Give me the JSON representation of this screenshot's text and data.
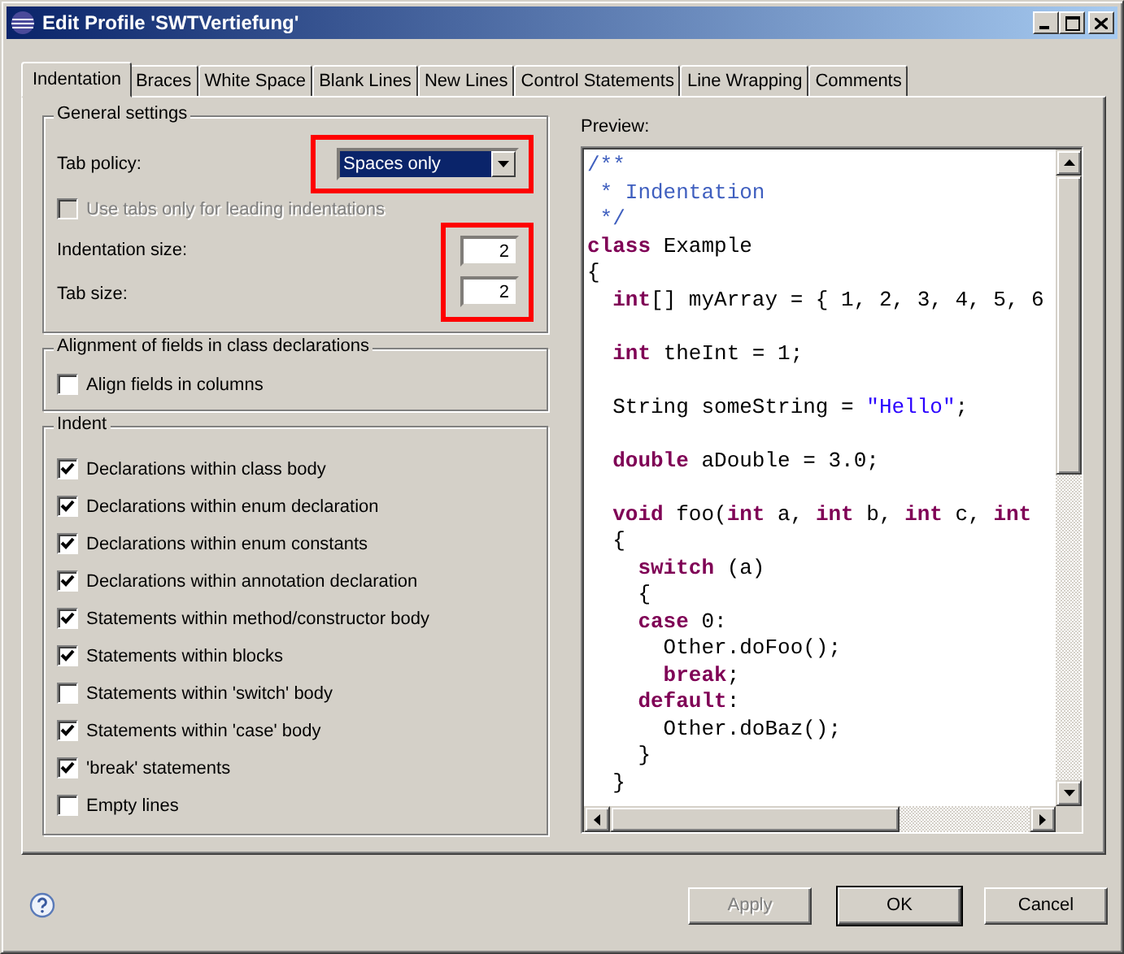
{
  "window": {
    "title": "Edit Profile 'SWTVertiefung'"
  },
  "tabs": [
    {
      "label": "Indentation",
      "selected": true
    },
    {
      "label": "Braces",
      "selected": false
    },
    {
      "label": "White Space",
      "selected": false
    },
    {
      "label": "Blank Lines",
      "selected": false
    },
    {
      "label": "New Lines",
      "selected": false
    },
    {
      "label": "Control Statements",
      "selected": false
    },
    {
      "label": "Line Wrapping",
      "selected": false
    },
    {
      "label": "Comments",
      "selected": false
    }
  ],
  "general_settings": {
    "title": "General settings",
    "tab_policy": {
      "label": "Tab policy:",
      "value": "Spaces only",
      "highlighted": true
    },
    "use_tabs_checkbox": {
      "label": "Use tabs only for leading indentations",
      "checked": false,
      "disabled": true
    },
    "sizes": {
      "highlighted": true,
      "fields": [
        {
          "label": "Indentation size:",
          "value": "2"
        },
        {
          "label": "Tab size:",
          "value": "2"
        }
      ]
    }
  },
  "alignment": {
    "title": "Alignment of fields in class declarations",
    "options": [
      {
        "label": "Align fields in columns",
        "checked": false
      }
    ]
  },
  "indent": {
    "title": "Indent",
    "options": [
      {
        "label": "Declarations within class body",
        "checked": true
      },
      {
        "label": "Declarations within enum declaration",
        "checked": true
      },
      {
        "label": "Declarations within enum constants",
        "checked": true
      },
      {
        "label": "Declarations within annotation declaration",
        "checked": true
      },
      {
        "label": "Statements within method/constructor body",
        "checked": true
      },
      {
        "label": "Statements within blocks",
        "checked": true
      },
      {
        "label": "Statements within 'switch' body",
        "checked": false
      },
      {
        "label": "Statements within 'case' body",
        "checked": true
      },
      {
        "label": "'break' statements",
        "checked": true
      },
      {
        "label": "Empty lines",
        "checked": false
      }
    ]
  },
  "preview": {
    "label": "Preview:",
    "lines": [
      {
        "kind": "code",
        "tokens": [
          {
            "kind": "comment",
            "text": "/**"
          }
        ]
      },
      {
        "kind": "code",
        "tokens": [
          {
            "kind": "comment",
            "text": " * Indentation"
          }
        ]
      },
      {
        "kind": "code",
        "tokens": [
          {
            "kind": "comment",
            "text": " */"
          }
        ]
      },
      {
        "kind": "code",
        "tokens": [
          {
            "kind": "keyword",
            "text": "class"
          },
          {
            "kind": "plain",
            "text": " Example"
          }
        ]
      },
      {
        "kind": "code",
        "tokens": [
          {
            "kind": "plain",
            "text": "{"
          }
        ]
      },
      {
        "kind": "code",
        "tokens": [
          {
            "kind": "keyword",
            "text": "  int"
          },
          {
            "kind": "plain",
            "text": "[] myArray = { 1, 2, 3, 4, 5, 6"
          }
        ]
      },
      {
        "kind": "blank"
      },
      {
        "kind": "code",
        "tokens": [
          {
            "kind": "keyword",
            "text": "  int"
          },
          {
            "kind": "plain",
            "text": " theInt = 1;"
          }
        ]
      },
      {
        "kind": "blank"
      },
      {
        "kind": "code",
        "tokens": [
          {
            "kind": "plain",
            "text": "  String someString = "
          },
          {
            "kind": "string",
            "text": "\"Hello\""
          },
          {
            "kind": "plain",
            "text": ";"
          }
        ]
      },
      {
        "kind": "blank"
      },
      {
        "kind": "code",
        "tokens": [
          {
            "kind": "keyword",
            "text": "  double"
          },
          {
            "kind": "plain",
            "text": " aDouble = 3.0;"
          }
        ]
      },
      {
        "kind": "blank"
      },
      {
        "kind": "code",
        "tokens": [
          {
            "kind": "keyword",
            "text": "  void"
          },
          {
            "kind": "plain",
            "text": " foo("
          },
          {
            "kind": "keyword",
            "text": "int"
          },
          {
            "kind": "plain",
            "text": " a, "
          },
          {
            "kind": "keyword",
            "text": "int"
          },
          {
            "kind": "plain",
            "text": " b, "
          },
          {
            "kind": "keyword",
            "text": "int"
          },
          {
            "kind": "plain",
            "text": " c, "
          },
          {
            "kind": "keyword",
            "text": "int"
          }
        ]
      },
      {
        "kind": "code",
        "tokens": [
          {
            "kind": "plain",
            "text": "  {"
          }
        ]
      },
      {
        "kind": "code",
        "tokens": [
          {
            "kind": "keyword",
            "text": "    switch"
          },
          {
            "kind": "plain",
            "text": " (a)"
          }
        ]
      },
      {
        "kind": "code",
        "tokens": [
          {
            "kind": "plain",
            "text": "    {"
          }
        ]
      },
      {
        "kind": "code",
        "tokens": [
          {
            "kind": "keyword",
            "text": "    case"
          },
          {
            "kind": "plain",
            "text": " 0:"
          }
        ]
      },
      {
        "kind": "code",
        "tokens": [
          {
            "kind": "plain",
            "text": "      Other.doFoo();"
          }
        ]
      },
      {
        "kind": "code",
        "tokens": [
          {
            "kind": "keyword",
            "text": "      break"
          },
          {
            "kind": "plain",
            "text": ";"
          }
        ]
      },
      {
        "kind": "code",
        "tokens": [
          {
            "kind": "keyword",
            "text": "    default"
          },
          {
            "kind": "plain",
            "text": ":"
          }
        ]
      },
      {
        "kind": "code",
        "tokens": [
          {
            "kind": "plain",
            "text": "      Other.doBaz();"
          }
        ]
      },
      {
        "kind": "code",
        "tokens": [
          {
            "kind": "plain",
            "text": "    }"
          }
        ]
      },
      {
        "kind": "code",
        "tokens": [
          {
            "kind": "plain",
            "text": "  }"
          }
        ]
      }
    ]
  },
  "buttons": [
    {
      "label": "Apply",
      "disabled": true,
      "default": false
    },
    {
      "label": "OK",
      "disabled": false,
      "default": true
    },
    {
      "label": "Cancel",
      "disabled": false,
      "default": false
    }
  ]
}
